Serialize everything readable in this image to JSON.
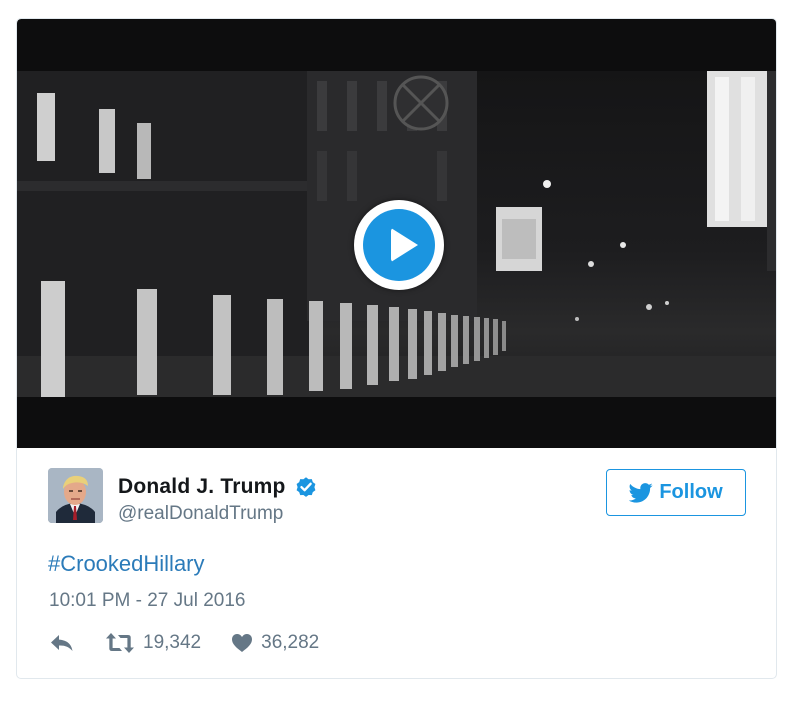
{
  "video": {
    "play_icon": "play-icon"
  },
  "tweet": {
    "display_name": "Donald J. Trump",
    "verified_icon": "verified-badge-icon",
    "handle": "@realDonaldTrump",
    "follow_label": "Follow",
    "follow_icon": "twitter-bird-icon",
    "text": "#CrookedHillary",
    "timestamp": "10:01 PM - 27 Jul 2016",
    "actions": {
      "reply_icon": "reply-icon",
      "retweet_icon": "retweet-icon",
      "retweet_count": "19,342",
      "like_icon": "heart-icon",
      "like_count": "36,282"
    }
  },
  "colors": {
    "accent": "#1b95e0",
    "hashtag": "#2b7bb9",
    "secondary_text": "#657786",
    "primary_text": "#14171a",
    "border": "#e1e8ed"
  }
}
